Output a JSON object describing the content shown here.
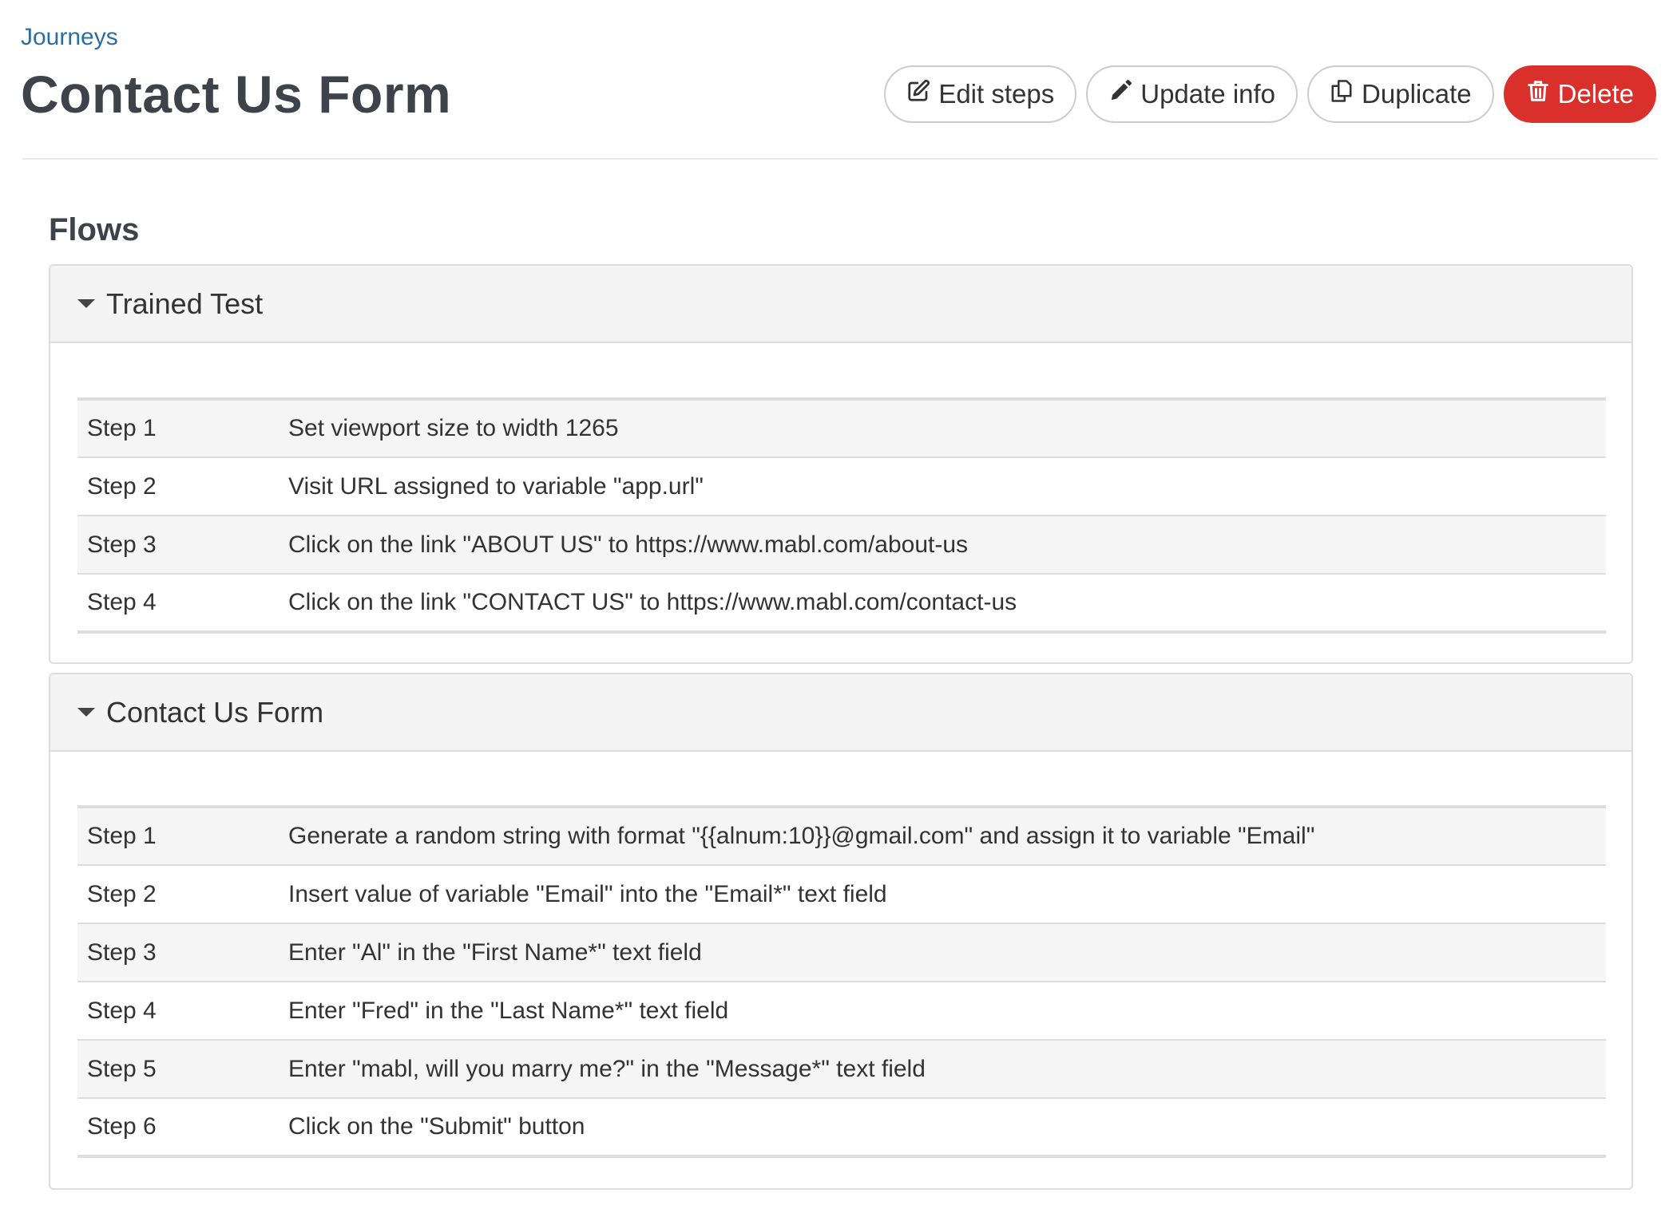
{
  "breadcrumb": "Journeys",
  "title": "Contact Us Form",
  "actions": {
    "edit_steps": "Edit steps",
    "update_info": "Update info",
    "duplicate": "Duplicate",
    "delete": "Delete"
  },
  "colors": {
    "link": "#2e6da4",
    "danger": "#d9302c",
    "panel_header": "#f4f4f4"
  },
  "flows_heading": "Flows",
  "flows": [
    {
      "name": "Trained Test",
      "steps": [
        {
          "label": "Step 1",
          "text": "Set viewport size to width 1265"
        },
        {
          "label": "Step 2",
          "text": "Visit URL assigned to variable \"app.url\""
        },
        {
          "label": "Step 3",
          "text": "Click on the link \"ABOUT US\" to https://www.mabl.com/about-us"
        },
        {
          "label": "Step 4",
          "text": "Click on the link \"CONTACT US\" to https://www.mabl.com/contact-us"
        }
      ]
    },
    {
      "name": "Contact Us Form",
      "steps": [
        {
          "label": "Step 1",
          "text": "Generate a random string with format \"{{alnum:10}}@gmail.com\" and assign it to variable \"Email\""
        },
        {
          "label": "Step 2",
          "text": "Insert value of variable \"Email\" into the \"Email*\" text field"
        },
        {
          "label": "Step 3",
          "text": "Enter \"Al\" in the \"First Name*\" text field"
        },
        {
          "label": "Step 4",
          "text": "Enter \"Fred\" in the \"Last Name*\" text field"
        },
        {
          "label": "Step 5",
          "text": "Enter \"mabl, will you marry me?\" in the \"Message*\" text field"
        },
        {
          "label": "Step 6",
          "text": "Click on the \"Submit\" button"
        }
      ]
    }
  ]
}
